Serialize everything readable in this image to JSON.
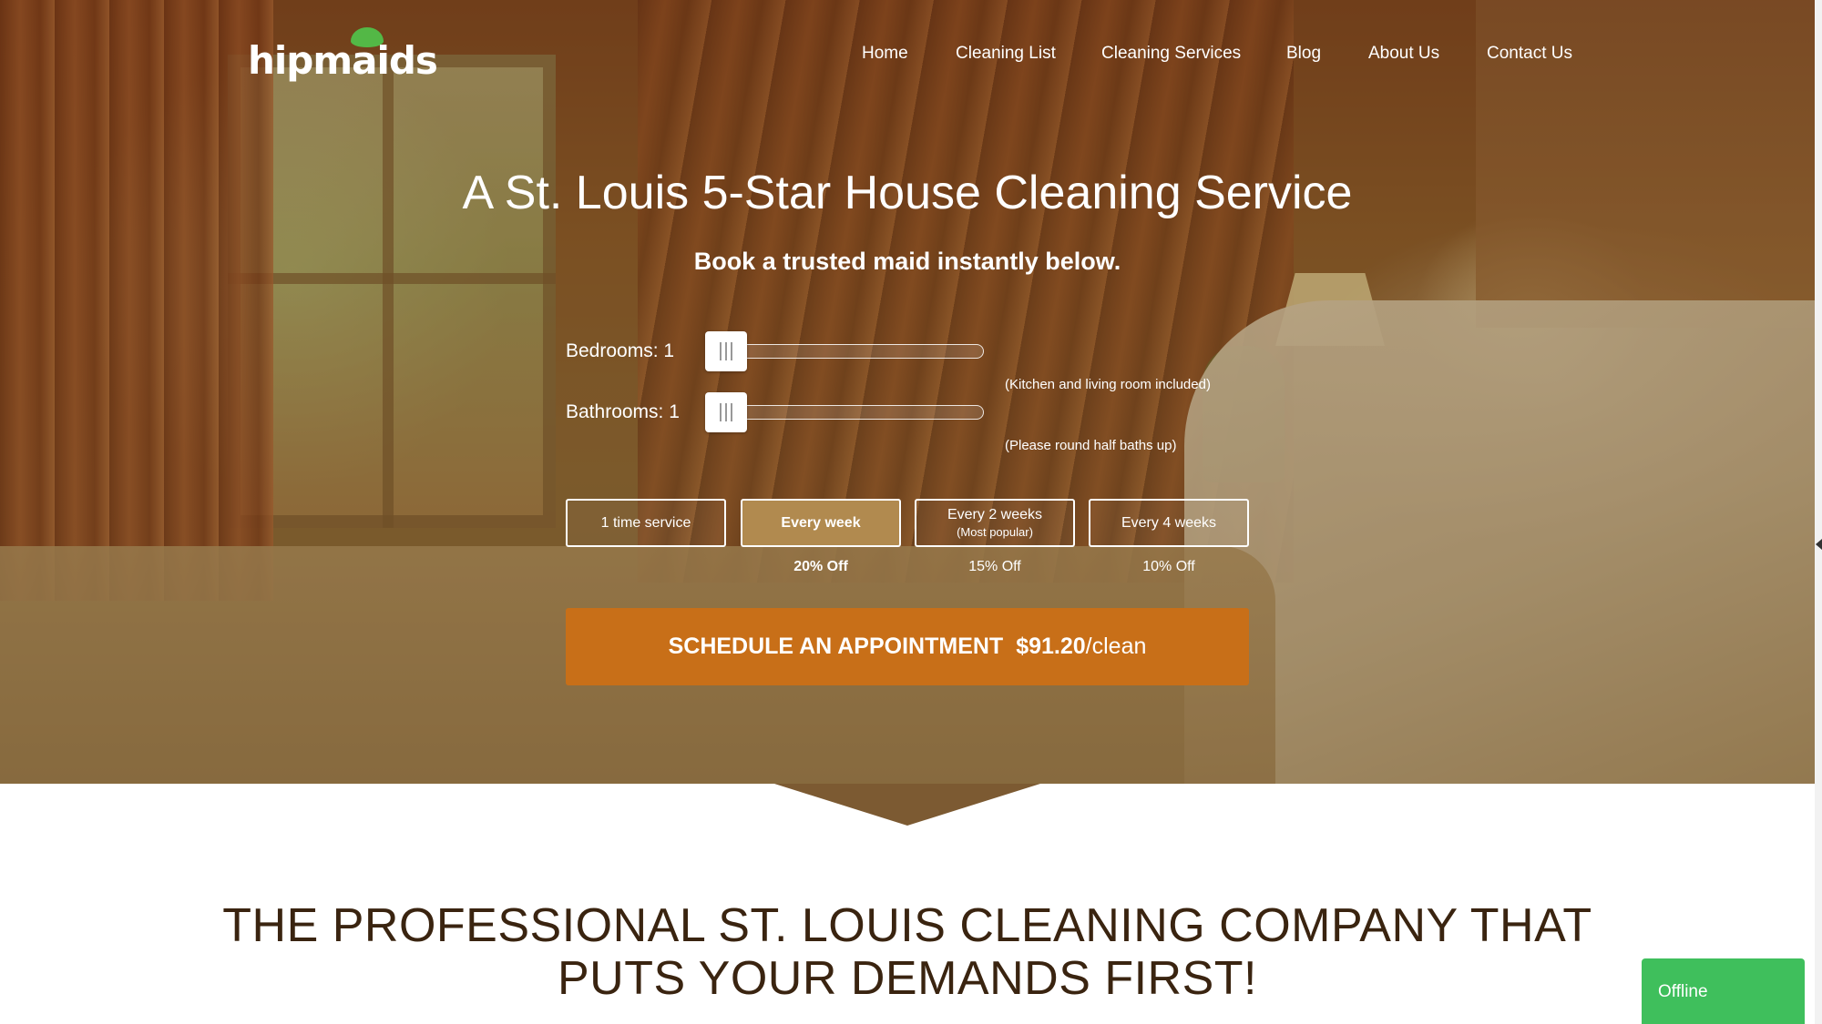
{
  "brand": {
    "name": "hipmaids",
    "leaf_color": "#53b846"
  },
  "nav": {
    "items": [
      "Home",
      "Cleaning List",
      "Cleaning Services",
      "Blog",
      "About Us",
      "Contact Us"
    ]
  },
  "hero": {
    "headline": "A St. Louis 5-Star House Cleaning Service",
    "subheadline": "Book a trusted maid instantly below."
  },
  "booking": {
    "bedrooms": {
      "label": "Bedrooms: 1",
      "value": 1,
      "note": "(Kitchen and living room included)"
    },
    "bathrooms": {
      "label": "Bathrooms: 1",
      "value": 1,
      "note": "(Please round half baths up)"
    },
    "frequencies": [
      {
        "label": "1 time service",
        "sub": "",
        "discount": "",
        "selected": false
      },
      {
        "label": "Every week",
        "sub": "",
        "discount": "20% Off",
        "selected": true
      },
      {
        "label": "Every 2 weeks",
        "sub": "(Most popular)",
        "discount": "15% Off",
        "selected": false
      },
      {
        "label": "Every 4 weeks",
        "sub": "",
        "discount": "10% Off",
        "selected": false
      }
    ],
    "cta": {
      "label": "SCHEDULE AN APPOINTMENT",
      "price": "$91.20",
      "unit": "/clean",
      "color": "#c86f18"
    },
    "selected_color": "#b18a4f"
  },
  "section": {
    "title_line1": "THE PROFESSIONAL ST. LOUIS CLEANING COMPANY THAT",
    "title_line2": "PUTS YOUR DEMANDS FIRST!"
  },
  "chat": {
    "status": "Offline",
    "color": "#3fbf5c"
  }
}
